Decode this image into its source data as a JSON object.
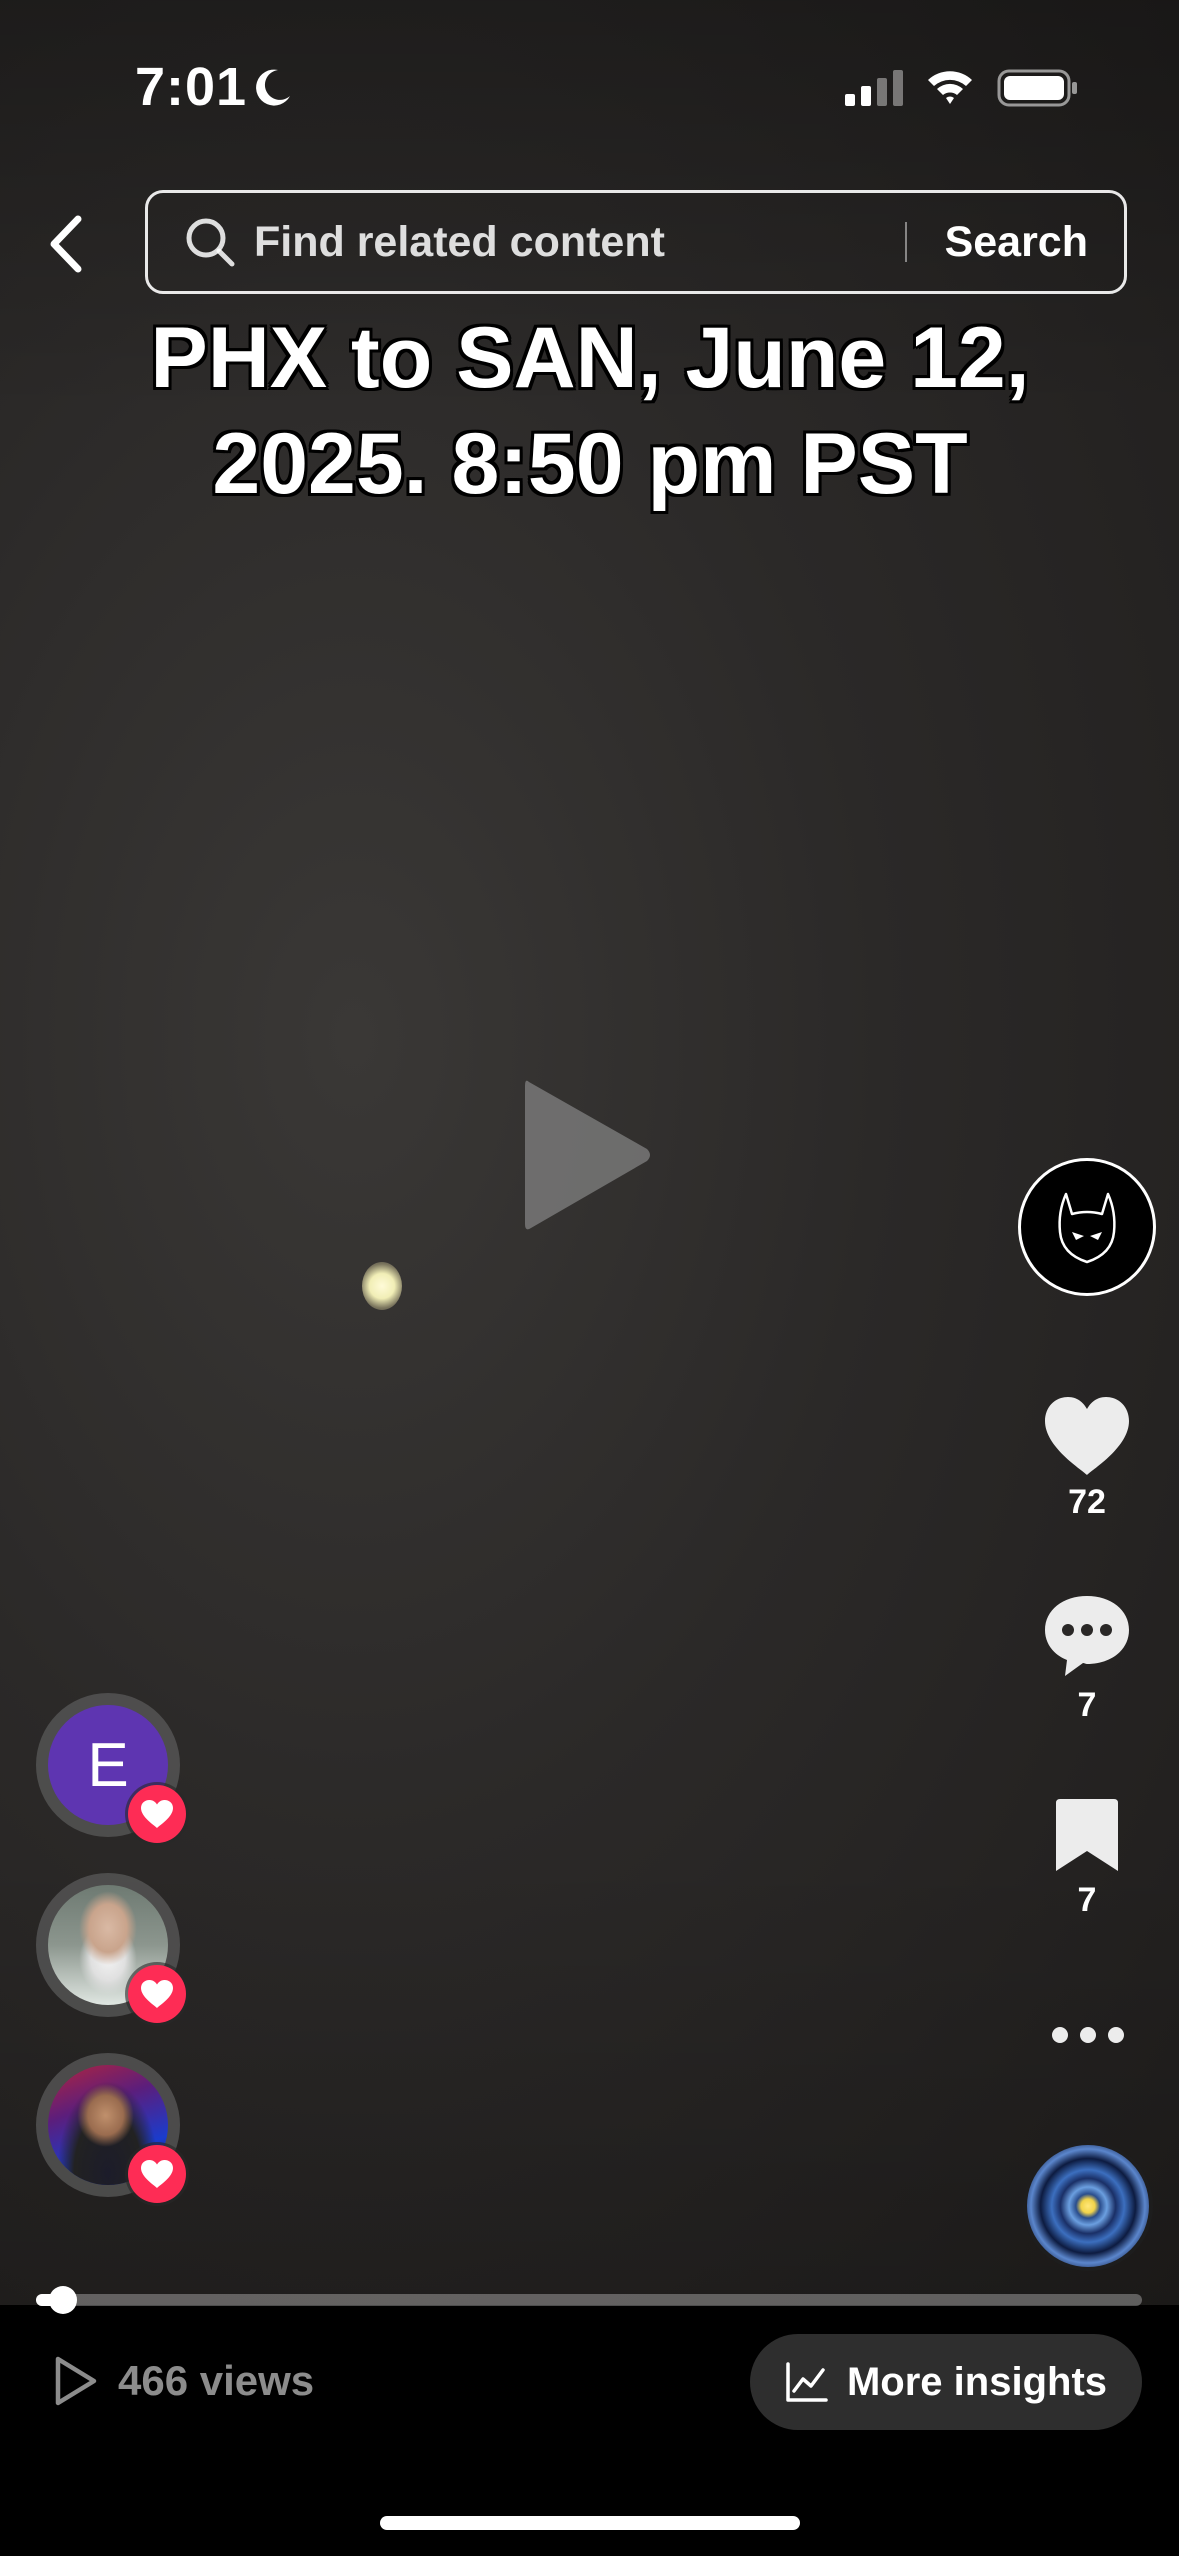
{
  "status_bar": {
    "time": "7:01",
    "icons": [
      "moon-icon",
      "cellular-signal-icon",
      "wifi-icon",
      "battery-icon"
    ]
  },
  "header": {
    "back_icon": "chevron-left-icon",
    "search": {
      "placeholder": "Find related content",
      "button_label": "Search"
    }
  },
  "video": {
    "caption": "PHX to SAN, June 12, 2025. 8:50 pm PST",
    "state": "paused",
    "progress_fraction": 0.024
  },
  "actions": {
    "creator_avatar": "batman-mask-icon",
    "likes": "72",
    "comments": "7",
    "saves": "7",
    "more_icon": "more-dots-icon",
    "sound_icon": "music-disc-icon"
  },
  "likers": [
    {
      "initial": "E",
      "badge": "heart-icon"
    },
    {
      "badge": "heart-icon"
    },
    {
      "badge": "heart-icon"
    }
  ],
  "footer": {
    "views_label": "466 views",
    "insights_label": "More insights"
  },
  "colors": {
    "heart_badge": "#fe2c55",
    "liker_initial_bg": "#5e35b1",
    "insights_button_bg": "#2e2e2e",
    "views_text": "#8c8c8c"
  }
}
